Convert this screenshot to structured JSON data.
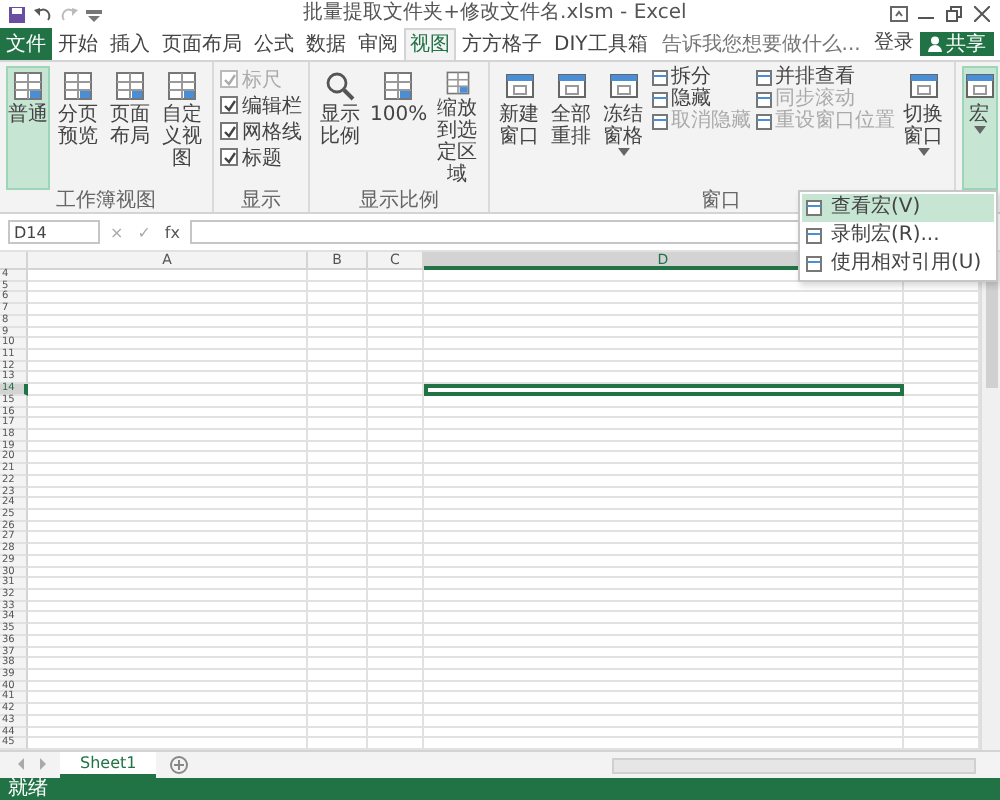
{
  "window": {
    "title": "批量提取文件夹+修改文件名.xlsm - Excel"
  },
  "tabs": [
    {
      "label": "文件",
      "kind": "file",
      "selected": false
    },
    {
      "label": "开始",
      "kind": "tab",
      "selected": false
    },
    {
      "label": "插入",
      "kind": "tab",
      "selected": false
    },
    {
      "label": "页面布局",
      "kind": "tab",
      "selected": false
    },
    {
      "label": "公式",
      "kind": "tab",
      "selected": false
    },
    {
      "label": "数据",
      "kind": "tab",
      "selected": false
    },
    {
      "label": "审阅",
      "kind": "tab",
      "selected": false
    },
    {
      "label": "视图",
      "kind": "tab",
      "selected": true
    },
    {
      "label": "方方格子",
      "kind": "tab",
      "selected": false
    },
    {
      "label": "DIY工具箱",
      "kind": "tab",
      "selected": false
    }
  ],
  "search": {
    "placeholder": "告诉我您想要做什么..."
  },
  "account": {
    "sign_in": "登录",
    "share": "共享"
  },
  "ribbon": {
    "groups": [
      {
        "label": "工作簿视图",
        "columns": [
          [
            {
              "kind": "large",
              "label": "普通",
              "selected": true
            }
          ],
          [
            {
              "kind": "large",
              "label": "分页预览",
              "selected": false
            }
          ],
          [
            {
              "kind": "large",
              "label": "页面布局",
              "selected": false
            }
          ],
          [
            {
              "kind": "large",
              "label": "自定义视图",
              "selected": false
            }
          ]
        ]
      },
      {
        "label": "显示",
        "columns": [
          [
            {
              "kind": "check",
              "label": "标尺",
              "checked": true,
              "disabled": true
            },
            {
              "kind": "check",
              "label": "编辑栏",
              "checked": true,
              "disabled": false
            },
            {
              "kind": "check",
              "label": "网格线",
              "checked": true,
              "disabled": false
            },
            {
              "kind": "check",
              "label": "标题",
              "checked": true,
              "disabled": false
            }
          ]
        ]
      },
      {
        "label": "显示比例",
        "columns": [
          [
            {
              "kind": "large",
              "label": "显示比例",
              "selected": false
            }
          ],
          [
            {
              "kind": "large",
              "label": "100%",
              "selected": false
            }
          ],
          [
            {
              "kind": "large",
              "label": "缩放到选定区域",
              "selected": false
            }
          ]
        ]
      },
      {
        "label": "窗口",
        "columns": [
          [
            {
              "kind": "large",
              "label": "新建窗口",
              "selected": false
            }
          ],
          [
            {
              "kind": "large",
              "label": "全部重排",
              "selected": false
            }
          ],
          [
            {
              "kind": "large",
              "label": "冻结窗格",
              "selected": false,
              "dropdown": true
            }
          ],
          [
            {
              "kind": "small",
              "label": "拆分",
              "disabled": false
            },
            {
              "kind": "small",
              "label": "隐藏",
              "disabled": false
            },
            {
              "kind": "small",
              "label": "取消隐藏",
              "disabled": true
            }
          ],
          [
            {
              "kind": "small",
              "label": "并排查看",
              "disabled": false
            },
            {
              "kind": "small",
              "label": "同步滚动",
              "disabled": true
            },
            {
              "kind": "small",
              "label": "重设窗口位置",
              "disabled": true
            }
          ],
          [
            {
              "kind": "large",
              "label": "切换窗口",
              "selected": false,
              "dropdown": true
            }
          ]
        ]
      },
      {
        "columns": [
          [
            {
              "kind": "large",
              "label": "宏",
              "selected": true,
              "dropdown": true
            }
          ]
        ]
      }
    ]
  },
  "menu": {
    "items": [
      {
        "label": "查看宏(V)",
        "selected": true
      },
      {
        "label": "录制宏(R)...",
        "selected": false
      },
      {
        "label": "使用相对引用(U)",
        "selected": false
      }
    ]
  },
  "formula_bar": {
    "name_box": "D14",
    "cancel": "×",
    "enter": "✓",
    "function": "fx"
  },
  "sheet": {
    "columns": [
      {
        "label": "A",
        "selected": false
      },
      {
        "label": "B",
        "selected": false
      },
      {
        "label": "C",
        "selected": false
      },
      {
        "label": "D",
        "selected": true
      }
    ],
    "rows": [
      {
        "label": "4",
        "selected": false
      },
      {
        "label": "5",
        "selected": false
      },
      {
        "label": "6",
        "selected": false
      },
      {
        "label": "7",
        "selected": false
      },
      {
        "label": "8",
        "selected": false
      },
      {
        "label": "9",
        "selected": false
      },
      {
        "label": "10",
        "selected": false
      },
      {
        "label": "11",
        "selected": false
      },
      {
        "label": "12",
        "selected": false
      },
      {
        "label": "13",
        "selected": false
      },
      {
        "label": "14",
        "selected": true
      },
      {
        "label": "15",
        "selected": false
      },
      {
        "label": "16",
        "selected": false
      },
      {
        "label": "17",
        "selected": false
      },
      {
        "label": "18",
        "selected": false
      },
      {
        "label": "19",
        "selected": false
      },
      {
        "label": "20",
        "selected": false
      },
      {
        "label": "21",
        "selected": false
      },
      {
        "label": "22",
        "selected": false
      },
      {
        "label": "23",
        "selected": false
      },
      {
        "label": "24",
        "selected": false
      },
      {
        "label": "25",
        "selected": false
      },
      {
        "label": "26",
        "selected": false
      },
      {
        "label": "27",
        "selected": false
      },
      {
        "label": "28",
        "selected": false
      },
      {
        "label": "29",
        "selected": false
      },
      {
        "label": "30",
        "selected": false
      },
      {
        "label": "31",
        "selected": false
      },
      {
        "label": "32",
        "selected": false
      },
      {
        "label": "33",
        "selected": false
      },
      {
        "label": "34",
        "selected": false
      },
      {
        "label": "35",
        "selected": false
      },
      {
        "label": "36",
        "selected": false
      },
      {
        "label": "37",
        "selected": false
      },
      {
        "label": "38",
        "selected": false
      },
      {
        "label": "39",
        "selected": false
      },
      {
        "label": "40",
        "selected": false
      },
      {
        "label": "41",
        "selected": false
      },
      {
        "label": "42",
        "selected": false
      },
      {
        "label": "43",
        "selected": false
      },
      {
        "label": "44",
        "selected": false
      },
      {
        "label": "45",
        "selected": false
      }
    ]
  },
  "sheet_tabs": [
    {
      "label": "Sheet1",
      "selected": true
    }
  ],
  "status_bar": {
    "text": "就绪"
  }
}
